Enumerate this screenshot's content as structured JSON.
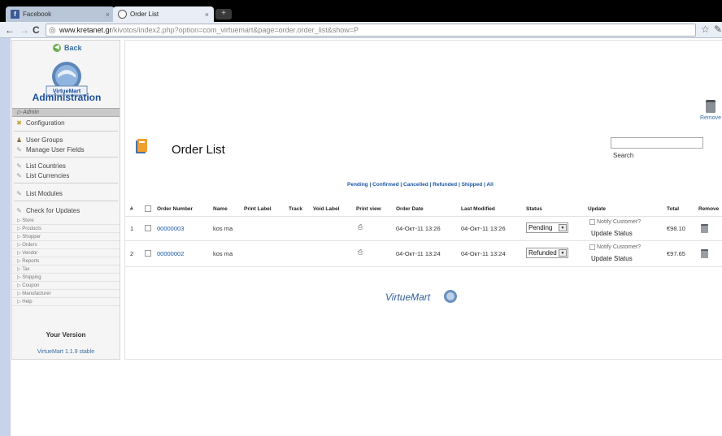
{
  "browser": {
    "tabs": [
      {
        "label": "Facebook",
        "active": false
      },
      {
        "label": "Order List",
        "active": true
      }
    ],
    "url_host": "www.kretanet.gr",
    "url_path": "/kivotos/index2.php?option=com_virtuemart&page=order.order_list&show=P"
  },
  "sidebar": {
    "back_label": "Back",
    "logo_text": "VirtueMart",
    "title": "Administration",
    "section_label": "Admin",
    "menu": [
      {
        "label": "Configuration",
        "icon": "wrench-icon"
      },
      {
        "label": "User Groups",
        "icon": "users-icon"
      },
      {
        "label": "Manage User Fields",
        "icon": "fields-icon"
      },
      {
        "label": "List Countries",
        "icon": "list-icon"
      },
      {
        "label": "List Currencies",
        "icon": "list-icon"
      },
      {
        "label": "List Modules",
        "icon": "list-icon"
      },
      {
        "label": "Check for Updates",
        "icon": "update-icon"
      }
    ],
    "sections": [
      "Store",
      "Products",
      "Shopper",
      "Orders",
      "Vendor",
      "Reports",
      "Tax",
      "Shipping",
      "Coupon",
      "Manufacturer",
      "Help"
    ],
    "your_version_label": "Your Version",
    "version_text": "VirtueMart 1.1.9 stable"
  },
  "main": {
    "title": "Order List",
    "remove_label": "Remove",
    "search_value": "",
    "search_button": "Search",
    "filters": [
      "Pending",
      "Confirmed",
      "Cancelled",
      "Refunded",
      "Shipped",
      "All"
    ],
    "columns": [
      "#",
      "Order Number",
      "Name",
      "Print Label",
      "Track",
      "Void Label",
      "Print view",
      "Order Date",
      "Last Modified",
      "Status",
      "Update",
      "Total",
      "Remove"
    ],
    "rows": [
      {
        "num": "1",
        "order_number": "00000003",
        "name": "kos ma",
        "order_date": "04-Окт-11 13:26",
        "last_modified": "04-Окт-11 13:26",
        "status": "Pending",
        "notify_label": "Notify Customer?",
        "update_label": "Update Status",
        "total": "€98.10"
      },
      {
        "num": "2",
        "order_number": "00000002",
        "name": "kos ma",
        "order_date": "04-Окт-11 13:24",
        "last_modified": "04-Окт-11 13:24",
        "status": "Refunded",
        "notify_label": "Notify Customer?",
        "update_label": "Update Status",
        "total": "€97.65"
      }
    ],
    "footer_logo": "VirtueMart"
  }
}
